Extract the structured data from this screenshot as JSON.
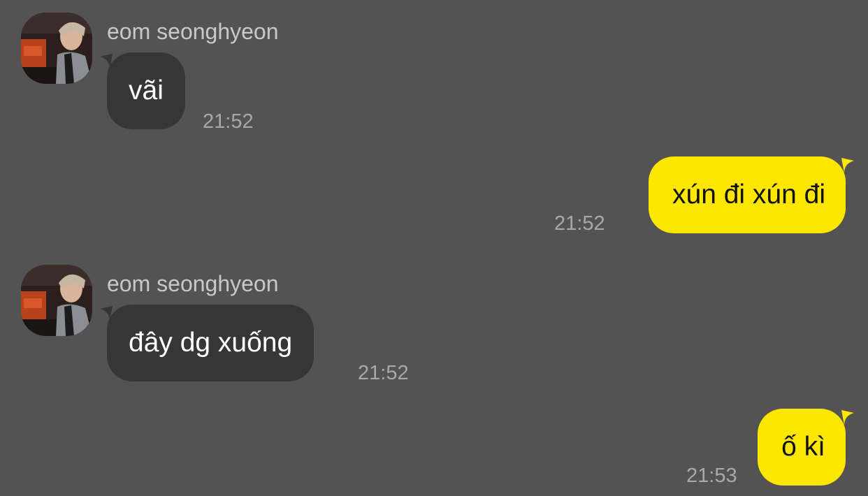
{
  "messages": [
    {
      "direction": "incoming",
      "sender": "eom seonghyeon",
      "text": "vãi",
      "time": "21:52"
    },
    {
      "direction": "outgoing",
      "text": "xún đi xún đi",
      "time": "21:52"
    },
    {
      "direction": "incoming",
      "sender": "eom seonghyeon",
      "text": "đây dg xuống",
      "time": "21:52"
    },
    {
      "direction": "outgoing",
      "text": "ố kì",
      "time": "21:53"
    }
  ],
  "colors": {
    "background": "#545354",
    "incoming_bubble": "#373637",
    "outgoing_bubble": "#fde600",
    "sender_name": "#c9c8c9",
    "timestamp": "#a9a8a9"
  }
}
